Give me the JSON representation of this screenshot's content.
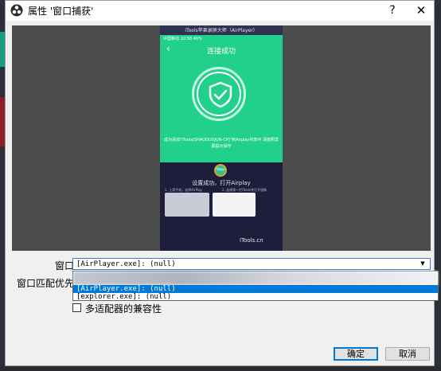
{
  "dialog": {
    "title": "属性 '窗口捕获'",
    "help": "?",
    "close": "✕"
  },
  "preview": {
    "window_title": "iTools苹果录屏大师（AirPlayer）",
    "status_bar": "中国移动  10:58  46%",
    "nav_title": "连接成功",
    "message": "成功添加\"iTools[SHAODUOJUN-CP]\"到Airplay列表中 请按照屏幕提示操作",
    "logo": "Steps",
    "setup_done": "设置成功，打开Airplay",
    "step1": "1. 上滑手机，选择AirPlay",
    "step2": "2. 选择第一栏iTools并打开镜像",
    "watermark": "iTools.cn"
  },
  "form": {
    "window_label": "窗口",
    "window_value": "[AirPlayer.exe]: (null)",
    "priority_label": "窗口匹配优先级",
    "options": [
      "[AirPlayer.exe]: (null)",
      "[explorer.exe]: (null)"
    ],
    "compat_label": "多适配器的兼容性",
    "compat_checked": false
  },
  "buttons": {
    "ok": "确定",
    "cancel": "取消"
  }
}
